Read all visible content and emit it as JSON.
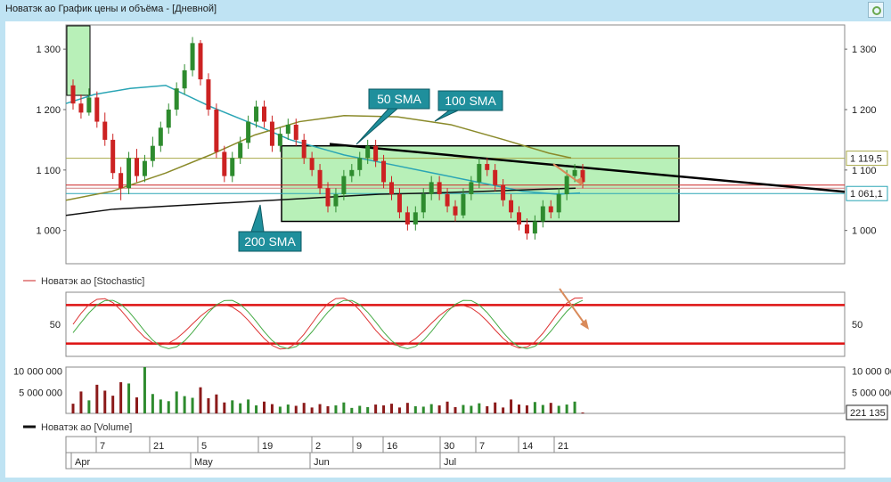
{
  "window": {
    "title": "Новатэк ао График цены и объёма - [Дневной]"
  },
  "chart_data": [
    {
      "type": "candlestick",
      "title": "",
      "y_ticks": [
        "1 300",
        "1 200",
        "1 100",
        "1 000"
      ],
      "ylim": [
        945,
        1340
      ],
      "price_labels": [
        "1 119,5",
        "1 061,1"
      ],
      "annotations": [
        "50 SMA",
        "100 SMA",
        "200 SMA"
      ],
      "colors": {
        "up": "#2e8b2e",
        "down": "#cc2222",
        "sma50": "#2aa5b5",
        "sma100": "#8a8a2a",
        "sma200": "#111111",
        "box": "#b8f0b8"
      },
      "candles": [
        [
          1240,
          1210,
          1250,
          1200
        ],
        [
          1210,
          1195,
          1225,
          1185
        ],
        [
          1195,
          1220,
          1235,
          1190
        ],
        [
          1220,
          1180,
          1230,
          1170
        ],
        [
          1180,
          1150,
          1195,
          1140
        ],
        [
          1150,
          1095,
          1160,
          1085
        ],
        [
          1095,
          1070,
          1105,
          1050
        ],
        [
          1070,
          1120,
          1130,
          1060
        ],
        [
          1120,
          1090,
          1135,
          1080
        ],
        [
          1090,
          1115,
          1125,
          1080
        ],
        [
          1115,
          1140,
          1155,
          1105
        ],
        [
          1140,
          1170,
          1180,
          1130
        ],
        [
          1170,
          1200,
          1210,
          1160
        ],
        [
          1200,
          1235,
          1245,
          1190
        ],
        [
          1235,
          1265,
          1275,
          1225
        ],
        [
          1265,
          1310,
          1320,
          1255
        ],
        [
          1310,
          1250,
          1315,
          1240
        ],
        [
          1250,
          1200,
          1260,
          1190
        ],
        [
          1200,
          1130,
          1210,
          1120
        ],
        [
          1130,
          1090,
          1140,
          1080
        ],
        [
          1090,
          1120,
          1130,
          1080
        ],
        [
          1120,
          1145,
          1155,
          1110
        ],
        [
          1145,
          1180,
          1190,
          1135
        ],
        [
          1180,
          1205,
          1215,
          1170
        ],
        [
          1205,
          1180,
          1215,
          1170
        ],
        [
          1180,
          1140,
          1190,
          1130
        ],
        [
          1140,
          1160,
          1170,
          1130
        ],
        [
          1160,
          1175,
          1185,
          1150
        ],
        [
          1175,
          1150,
          1185,
          1140
        ],
        [
          1150,
          1120,
          1160,
          1110
        ],
        [
          1120,
          1100,
          1130,
          1090
        ],
        [
          1100,
          1070,
          1110,
          1060
        ],
        [
          1070,
          1040,
          1080,
          1030
        ],
        [
          1040,
          1060,
          1070,
          1030
        ],
        [
          1060,
          1090,
          1100,
          1050
        ],
        [
          1090,
          1100,
          1110,
          1080
        ],
        [
          1100,
          1120,
          1130,
          1090
        ],
        [
          1120,
          1140,
          1150,
          1110
        ],
        [
          1140,
          1115,
          1150,
          1105
        ],
        [
          1115,
          1080,
          1125,
          1070
        ],
        [
          1080,
          1060,
          1090,
          1050
        ],
        [
          1060,
          1030,
          1070,
          1020
        ],
        [
          1030,
          1010,
          1040,
          1000
        ],
        [
          1010,
          1030,
          1040,
          1000
        ],
        [
          1030,
          1060,
          1070,
          1020
        ],
        [
          1060,
          1080,
          1090,
          1050
        ],
        [
          1080,
          1060,
          1090,
          1050
        ],
        [
          1060,
          1040,
          1070,
          1030
        ],
        [
          1040,
          1025,
          1050,
          1015
        ],
        [
          1025,
          1060,
          1070,
          1020
        ],
        [
          1060,
          1080,
          1090,
          1050
        ],
        [
          1080,
          1110,
          1120,
          1070
        ],
        [
          1110,
          1100,
          1120,
          1090
        ],
        [
          1100,
          1075,
          1110,
          1065
        ],
        [
          1075,
          1050,
          1085,
          1040
        ],
        [
          1050,
          1030,
          1060,
          1020
        ],
        [
          1030,
          1010,
          1040,
          1000
        ],
        [
          1010,
          995,
          1020,
          985
        ],
        [
          995,
          1015,
          1025,
          985
        ],
        [
          1015,
          1040,
          1050,
          1005
        ],
        [
          1040,
          1030,
          1050,
          1020
        ],
        [
          1030,
          1060,
          1070,
          1020
        ],
        [
          1060,
          1090,
          1100,
          1050
        ],
        [
          1090,
          1100,
          1110,
          1080
        ],
        [
          1100,
          1080,
          1110,
          1070
        ]
      ],
      "x_day_labels": [
        "7",
        "21",
        "5",
        "19",
        "2",
        "9",
        "16",
        "30",
        "7",
        "14",
        "21"
      ],
      "x_month_labels": [
        "Apr",
        "May",
        "Jun",
        "Jul"
      ]
    },
    {
      "type": "line",
      "legend": "Новатэк ао [Stochastic]",
      "y_ticks": [
        "50"
      ],
      "levels": [
        80,
        20
      ],
      "ylim": [
        0,
        100
      ]
    },
    {
      "type": "bar",
      "legend": "Новатэк ао [Volume]",
      "y_ticks": [
        "10 000 000",
        "5 000 000"
      ],
      "last_value_label": "221 135",
      "ylim": [
        0,
        11000000
      ],
      "values": [
        2300000,
        5200000,
        3100000,
        6800000,
        5400000,
        4200000,
        7400000,
        7100000,
        3800000,
        12000000,
        4600000,
        3300000,
        2900000,
        5200000,
        4100000,
        3700000,
        6200000,
        3600000,
        4500000,
        2600000,
        3100000,
        2400000,
        3300000,
        1900000,
        2800000,
        2200000,
        1600000,
        2100000,
        1800000,
        2500000,
        1400000,
        2200000,
        1700000,
        1900000,
        2600000,
        1300000,
        1800000,
        1500000,
        2100000,
        1900000,
        2300000,
        1400000,
        2500000,
        1700000,
        1600000,
        2200000,
        1900000,
        2800000,
        1500000,
        2000000,
        1800000,
        2400000,
        1700000,
        2600000,
        1400000,
        3300000,
        2100000,
        1900000,
        2700000,
        2000000,
        2500000,
        1800000,
        2100000,
        2800000,
        221135
      ]
    }
  ]
}
